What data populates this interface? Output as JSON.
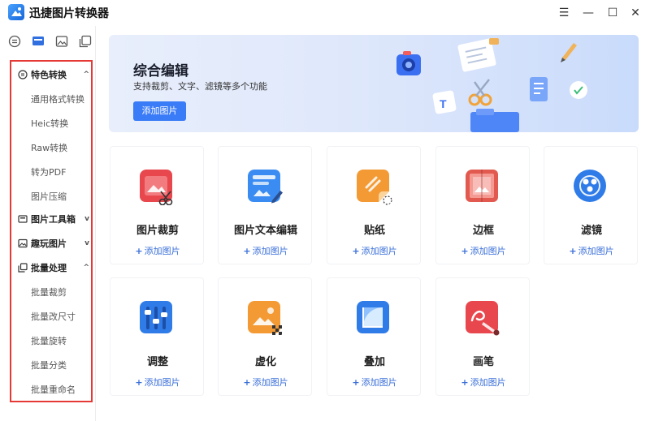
{
  "app": {
    "title": "迅捷图片转换器"
  },
  "window_controls": {
    "menu": "☰",
    "minimize": "—",
    "maximize": "☐",
    "close": "✕"
  },
  "sidebar": {
    "groups": [
      {
        "label": "特色转换",
        "chevron": "^",
        "items": [
          "通用格式转换",
          "Heic转换",
          "Raw转换",
          "转为PDF",
          "图片压缩"
        ]
      },
      {
        "label": "图片工具箱",
        "chevron": "v",
        "items": []
      },
      {
        "label": "趣玩图片",
        "chevron": "v",
        "items": []
      },
      {
        "label": "批量处理",
        "chevron": "^",
        "items": [
          "批量裁剪",
          "批量改尺寸",
          "批量旋转",
          "批量分类",
          "批量重命名"
        ]
      }
    ]
  },
  "banner": {
    "title": "综合编辑",
    "subtitle": "支持裁剪、文字、滤镜等多个功能",
    "button": "添加图片"
  },
  "tools": [
    {
      "label": "图片裁剪",
      "add": "添加图片",
      "icon": "crop-icon",
      "color": "#e8474d"
    },
    {
      "label": "图片文本编辑",
      "add": "添加图片",
      "icon": "text-edit-icon",
      "color": "#3b8cf2"
    },
    {
      "label": "贴纸",
      "add": "添加图片",
      "icon": "sticker-icon",
      "color": "#f39a35"
    },
    {
      "label": "边框",
      "add": "添加图片",
      "icon": "border-icon",
      "color": "#e25a4f"
    },
    {
      "label": "滤镜",
      "add": "添加图片",
      "icon": "filter-icon",
      "color": "#2f7be8"
    },
    {
      "label": "调整",
      "add": "添加图片",
      "icon": "adjust-icon",
      "color": "#2f7be8"
    },
    {
      "label": "虚化",
      "add": "添加图片",
      "icon": "blur-icon",
      "color": "#f39a35"
    },
    {
      "label": "叠加",
      "add": "添加图片",
      "icon": "overlay-icon",
      "color": "#2f7be8"
    },
    {
      "label": "画笔",
      "add": "添加图片",
      "icon": "brush-icon",
      "color": "#e8474d"
    }
  ]
}
